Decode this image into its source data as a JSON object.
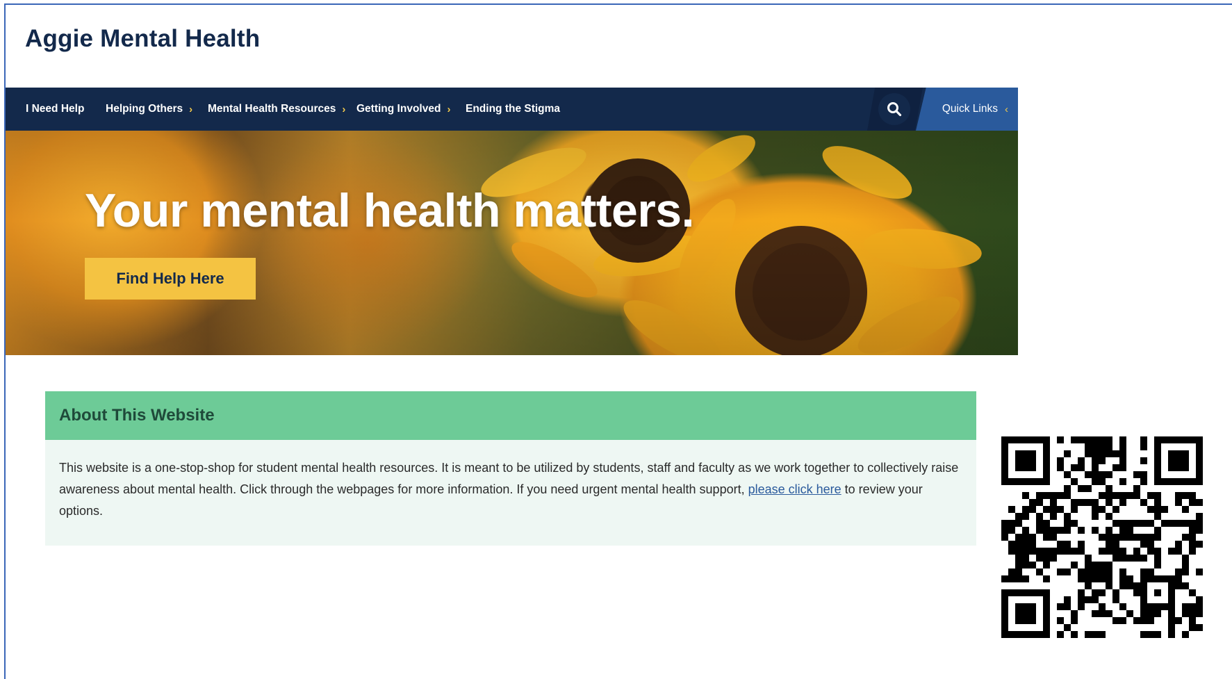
{
  "site": {
    "title": "Aggie Mental Health"
  },
  "nav": {
    "items": [
      {
        "label": "I Need Help",
        "has_submenu": false
      },
      {
        "label": "Helping Others",
        "has_submenu": true
      },
      {
        "label": "Mental Health Resources",
        "has_submenu": true
      },
      {
        "label": "Getting Involved",
        "has_submenu": true
      },
      {
        "label": "Ending the Stigma",
        "has_submenu": false
      }
    ],
    "search_icon": "search-icon",
    "quick_links_label": "Quick Links"
  },
  "hero": {
    "headline": "Your mental health matters.",
    "button_label": "Find Help Here"
  },
  "about": {
    "heading": "About This Website",
    "body_text_before_link": "This website is a one-stop-shop for student mental health resources. It is meant to be utilized by students, staff and faculty as we work together to collectively raise awareness about mental health. Click through the webpages for more information. If you need urgent mental health support, ",
    "link_text": "please click here",
    "body_text_after_link": " to review your options."
  },
  "colors": {
    "navy": "#13294b",
    "nav_accent_blue": "#2a5a9c",
    "gold": "#f4c342",
    "about_header_green": "#6dcb97",
    "about_body_bg": "#eef7f3"
  },
  "qr_code": {
    "icon": "qr-code"
  }
}
